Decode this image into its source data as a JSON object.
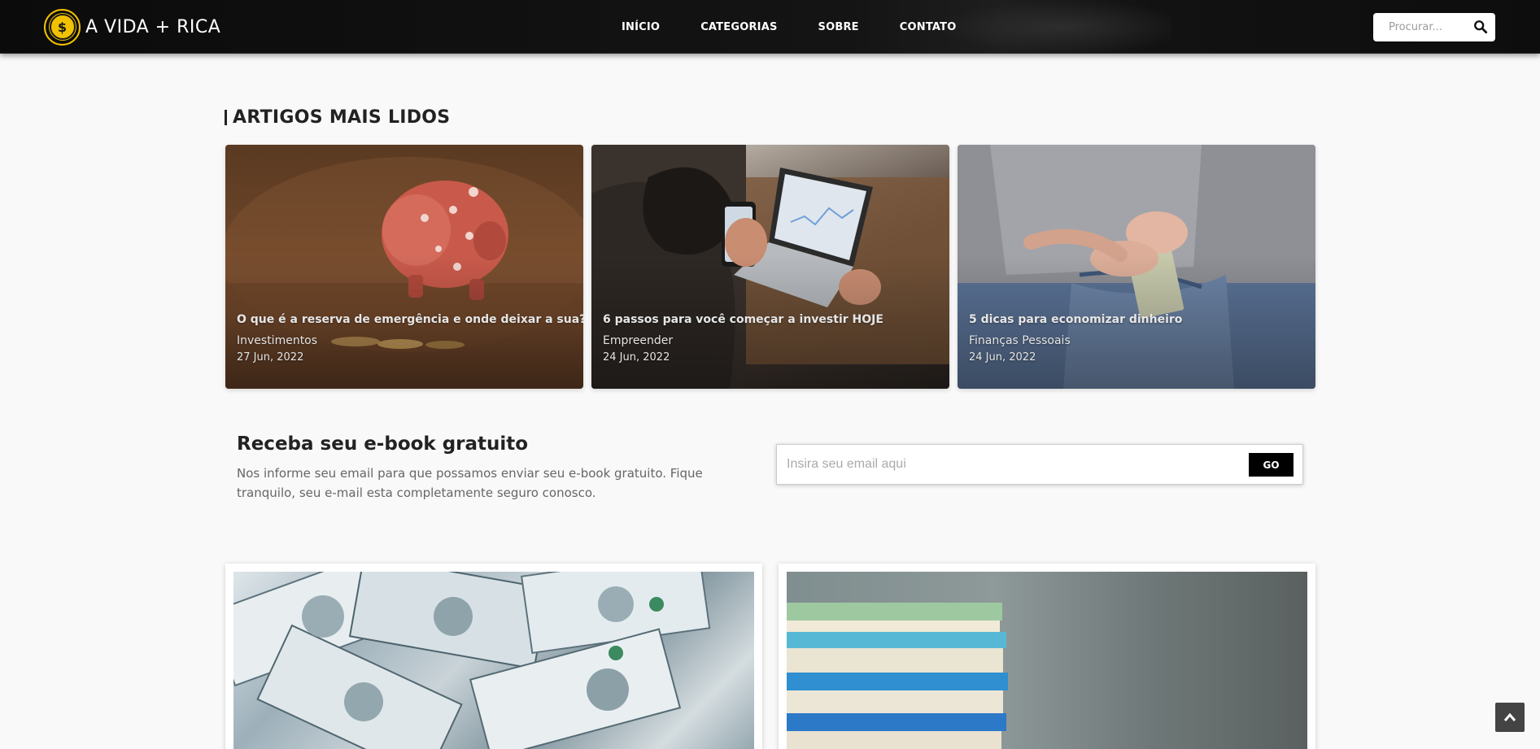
{
  "header": {
    "logo_text": "A VIDA + RICA",
    "logo_coin_symbol": "$",
    "nav": [
      {
        "label": "INÍCIO"
      },
      {
        "label": "CATEGORIAS"
      },
      {
        "label": "SOBRE"
      },
      {
        "label": "CONTATO"
      }
    ],
    "search_placeholder": "Procurar...",
    "search_icon": "search-icon"
  },
  "most_read": {
    "title": "ARTIGOS MAIS LIDOS",
    "articles": [
      {
        "title": "O que é a reserva de emergência e onde deixar a sua?",
        "category": "Investimentos",
        "date": "27 Jun, 2022"
      },
      {
        "title": "6 passos para você começar a investir HOJE",
        "category": "Empreender",
        "date": "24 Jun, 2022"
      },
      {
        "title": "5 dicas para economizar dinheiro",
        "category": "Finanças Pessoais",
        "date": "24 Jun, 2022"
      }
    ]
  },
  "newsletter": {
    "title": "Receba seu e-book gratuito",
    "text": "Nos informe seu email para que possamos enviar seu e-book gratuito. Fique tranquilo, seu e-mail esta completamente seguro conosco.",
    "email_placeholder": "Insira seu email aqui",
    "button_label": "GO"
  },
  "colors": {
    "accent_gold": "#f2c200",
    "header_bg": "#0b0b0b",
    "page_bg": "#f9f9f9"
  }
}
